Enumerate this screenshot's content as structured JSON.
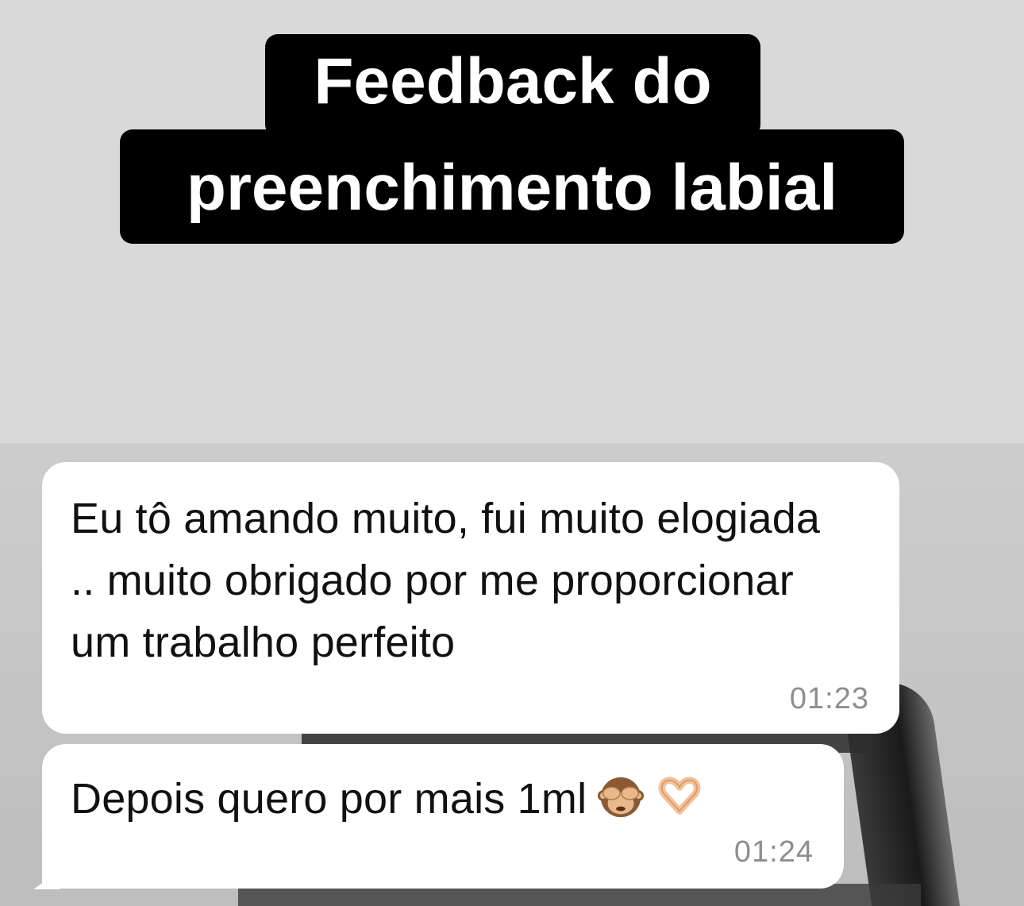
{
  "title": {
    "line1": "Feedback do",
    "line2": "preenchimento labial"
  },
  "messages": [
    {
      "text": "Eu tô amando muito, fui muito elogiada .. muito obrigado por me proporcionar um trabalho perfeito",
      "time": "01:23"
    },
    {
      "text": "Depois quero por mais 1ml",
      "emojis": [
        "see-no-evil-monkey",
        "heart-hands"
      ],
      "time": "01:24"
    }
  ],
  "colors": {
    "top_background": "#d9d9d9",
    "title_background": "#000000",
    "title_text": "#ffffff",
    "bubble_background": "#ffffff",
    "timestamp_text": "#8e8e8e"
  }
}
